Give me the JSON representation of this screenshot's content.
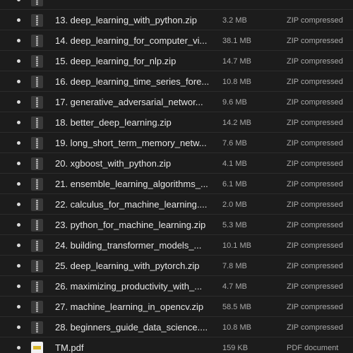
{
  "files": [
    {
      "name": "",
      "size": "",
      "kind": "",
      "icon": "zip-icon"
    },
    {
      "name": "13. deep_learning_with_python.zip",
      "size": "3.2 MB",
      "kind": "ZIP compressed",
      "icon": "zip-icon"
    },
    {
      "name": "14. deep_learning_for_computer_vi...",
      "size": "38.1 MB",
      "kind": "ZIP compressed",
      "icon": "zip-icon"
    },
    {
      "name": "15. deep_learning_for_nlp.zip",
      "size": "14.7 MB",
      "kind": "ZIP compressed",
      "icon": "zip-icon"
    },
    {
      "name": "16. deep_learning_time_series_fore...",
      "size": "10.8 MB",
      "kind": "ZIP compressed",
      "icon": "zip-icon"
    },
    {
      "name": "17. generative_adversarial_networ...",
      "size": "9.6 MB",
      "kind": "ZIP compressed",
      "icon": "zip-icon"
    },
    {
      "name": "18. better_deep_learning.zip",
      "size": "14.2 MB",
      "kind": "ZIP compressed",
      "icon": "zip-icon"
    },
    {
      "name": "19. long_short_term_memory_netw...",
      "size": "7.6 MB",
      "kind": "ZIP compressed",
      "icon": "zip-icon"
    },
    {
      "name": "20. xgboost_with_python.zip",
      "size": "4.1 MB",
      "kind": "ZIP compressed",
      "icon": "zip-icon"
    },
    {
      "name": "21. ensemble_learning_algorithms_...",
      "size": "6.1 MB",
      "kind": "ZIP compressed",
      "icon": "zip-icon"
    },
    {
      "name": "22. calculus_for_machine_learning....",
      "size": "2.0 MB",
      "kind": "ZIP compressed",
      "icon": "zip-icon"
    },
    {
      "name": "23. python_for_machine_learning.zip",
      "size": "5.3 MB",
      "kind": "ZIP compressed",
      "icon": "zip-icon"
    },
    {
      "name": "24. building_transformer_models_...",
      "size": "10.1 MB",
      "kind": "ZIP compressed",
      "icon": "zip-icon"
    },
    {
      "name": "25. deep_learning_with_pytorch.zip",
      "size": "7.8 MB",
      "kind": "ZIP compressed",
      "icon": "zip-icon"
    },
    {
      "name": "26. maximizing_productivity_with_...",
      "size": "4.7 MB",
      "kind": "ZIP compressed",
      "icon": "zip-icon"
    },
    {
      "name": "27. machine_learning_in_opencv.zip",
      "size": "58.5 MB",
      "kind": "ZIP compressed",
      "icon": "zip-icon"
    },
    {
      "name": "28. beginners_guide_data_science....",
      "size": "10.8 MB",
      "kind": "ZIP compressed",
      "icon": "zip-icon"
    },
    {
      "name": "TM.pdf",
      "size": "159 KB",
      "kind": "PDF document",
      "icon": "pdf-icon"
    }
  ]
}
